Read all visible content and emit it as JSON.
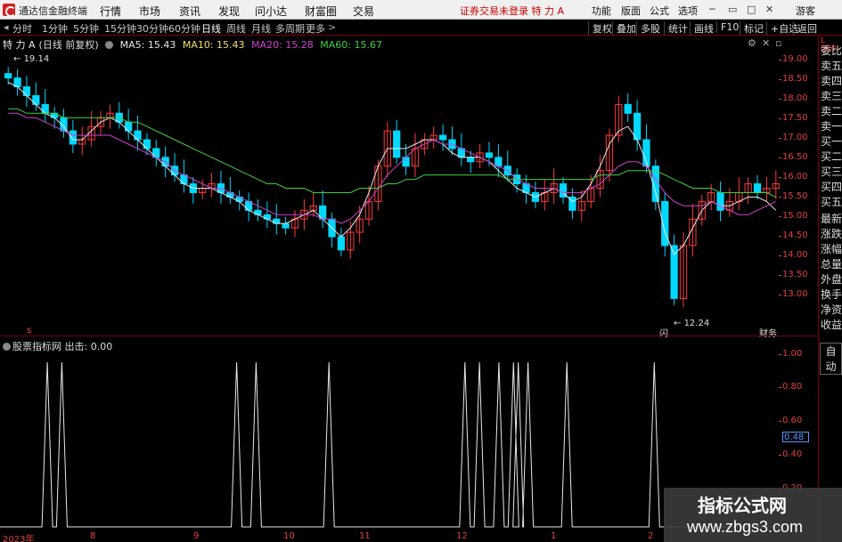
{
  "menubar": {
    "app_title": "通达信金融终端",
    "menus": [
      "行情",
      "市场",
      "资讯",
      "发现",
      "问小达",
      "财富圈",
      "交易"
    ],
    "status_text": "证券交易未登录",
    "stock_title": "特 力 A",
    "right_items": [
      "功能",
      "版面",
      "公式",
      "选项"
    ],
    "user": "游客"
  },
  "periods": {
    "tabs": [
      "分时",
      "1分钟",
      "5分钟",
      "15分钟",
      "30分钟",
      "60分钟",
      "日线",
      "周线",
      "月线",
      "多周期",
      "更多"
    ],
    "active": "日线",
    "more_arrow": ">",
    "tools": [
      "复权",
      "叠加",
      "多股",
      "统计",
      "画线",
      "F10",
      "标记",
      "+自选",
      "返回"
    ]
  },
  "main_chart": {
    "stock": "特 力 A",
    "period_note": "(日线 前复权)",
    "ma_labels": [
      {
        "text": "MA5: 15.43",
        "color": "#e8e8e8"
      },
      {
        "text": "MA10: 15.43",
        "color": "#f0e060"
      },
      {
        "text": "MA20: 15.28",
        "color": "#d040d0"
      },
      {
        "text": "MA60: 15.67",
        "color": "#40d040"
      }
    ],
    "max_label": "19.14",
    "min_label": "12.24",
    "marker_cai": "财务",
    "marker_shan": "闪",
    "marker_s": "s",
    "y_ticks": [
      "19.00",
      "18.50",
      "18.00",
      "17.50",
      "17.00",
      "16.50",
      "16.00",
      "15.50",
      "15.00",
      "14.50",
      "14.00",
      "13.50",
      "13.00"
    ]
  },
  "sub_chart": {
    "title": "股票指标网",
    "value_label": "出击: 0.00",
    "y_ticks": [
      "1.00",
      "0.80",
      "0.60",
      "0.40",
      "0.20"
    ],
    "cursor_value": "0.48"
  },
  "time_axis": [
    "2023年",
    "8",
    "9",
    "10",
    "11",
    "12",
    "1",
    "2"
  ],
  "right_panel": {
    "top_label": "L 000",
    "items": [
      "委比",
      "卖五",
      "卖四",
      "卖三",
      "卖二",
      "卖一",
      "买一",
      "买二",
      "买三",
      "买四",
      "买五",
      "最新",
      "涨跌",
      "涨幅",
      "总量",
      "外盘",
      "换手",
      "净资",
      "收益"
    ],
    "auto": "自动"
  },
  "watermark": {
    "line1": "指标公式网",
    "line2": "www.zbgs3.com"
  },
  "chart_data": [
    {
      "type": "line",
      "description_series": "price_closes_daily_approx",
      "series": [
        {
          "name": "K线收盘",
          "values": [
            18.4,
            18.2,
            18.0,
            17.8,
            17.6,
            17.5,
            17.2,
            16.9,
            17.0,
            17.3,
            17.5,
            17.6,
            17.4,
            17.2,
            17.0,
            16.8,
            16.6,
            16.4,
            16.2,
            16.0,
            15.8,
            15.9,
            16.0,
            15.8,
            15.7,
            15.6,
            15.4,
            15.3,
            15.2,
            15.1,
            15.0,
            15.2,
            15.4,
            15.5,
            15.2,
            14.8,
            14.5,
            14.9,
            15.2,
            15.6,
            16.4,
            17.2,
            16.6,
            16.4,
            16.8,
            17.0,
            17.1,
            17.0,
            16.8,
            16.6,
            16.5,
            16.7,
            16.6,
            16.4,
            16.2,
            16.0,
            15.8,
            15.6,
            15.8,
            16.0,
            15.7,
            15.4,
            15.6,
            15.9,
            16.3,
            17.1,
            17.8,
            17.6,
            17.0,
            16.4,
            15.6,
            14.6,
            13.4,
            14.6,
            15.2,
            15.6,
            15.8,
            15.4,
            15.6,
            15.8,
            16.0,
            15.8,
            15.9,
            16.0
          ]
        },
        {
          "name": "MA5",
          "values": [
            18.3,
            18.2,
            18.0,
            17.8,
            17.6,
            17.5,
            17.3,
            17.0,
            17.0,
            17.2,
            17.4,
            17.5,
            17.4,
            17.2,
            17.0,
            16.8,
            16.6,
            16.4,
            16.2,
            16.0,
            15.9,
            15.9,
            15.9,
            15.8,
            15.7,
            15.6,
            15.4,
            15.3,
            15.2,
            15.1,
            15.1,
            15.2,
            15.3,
            15.4,
            15.2,
            15.0,
            14.8,
            15.0,
            15.3,
            15.8,
            16.4,
            16.8,
            16.8,
            16.8,
            16.9,
            17.0,
            17.0,
            16.9,
            16.7,
            16.6,
            16.6,
            16.6,
            16.5,
            16.3,
            16.1,
            15.9,
            15.8,
            15.7,
            15.8,
            15.9,
            15.8,
            15.6,
            15.7,
            16.0,
            16.4,
            16.9,
            17.2,
            17.3,
            17.0,
            16.5,
            15.8,
            14.9,
            14.4,
            14.6,
            15.0,
            15.4,
            15.6,
            15.5,
            15.5,
            15.6,
            15.7,
            15.7,
            15.6,
            15.4
          ]
        },
        {
          "name": "MA20",
          "values": [
            17.6,
            17.6,
            17.5,
            17.5,
            17.4,
            17.3,
            17.2,
            17.1,
            17.1,
            17.1,
            17.1,
            17.1,
            17.0,
            16.9,
            16.8,
            16.7,
            16.6,
            16.5,
            16.3,
            16.2,
            16.1,
            16.0,
            15.9,
            15.9,
            15.8,
            15.7,
            15.6,
            15.5,
            15.4,
            15.3,
            15.3,
            15.3,
            15.3,
            15.3,
            15.2,
            15.2,
            15.1,
            15.2,
            15.4,
            15.6,
            15.9,
            16.2,
            16.4,
            16.6,
            16.8,
            16.9,
            17.0,
            16.9,
            16.9,
            16.8,
            16.7,
            16.6,
            16.5,
            16.4,
            16.3,
            16.1,
            16.0,
            15.9,
            15.9,
            15.9,
            15.8,
            15.8,
            15.8,
            15.9,
            16.0,
            16.2,
            16.4,
            16.5,
            16.5,
            16.4,
            16.1,
            15.8,
            15.6,
            15.5,
            15.5,
            15.5,
            15.6,
            15.5,
            15.4,
            15.3,
            15.3,
            15.4,
            15.5,
            15.6
          ]
        },
        {
          "name": "MA60",
          "values": [
            17.7,
            17.7,
            17.6,
            17.6,
            17.6,
            17.6,
            17.5,
            17.5,
            17.5,
            17.5,
            17.5,
            17.5,
            17.5,
            17.4,
            17.4,
            17.3,
            17.2,
            17.1,
            17.0,
            16.9,
            16.8,
            16.7,
            16.6,
            16.5,
            16.4,
            16.3,
            16.2,
            16.1,
            16.0,
            16.0,
            15.9,
            15.9,
            15.9,
            15.8,
            15.8,
            15.8,
            15.8,
            15.8,
            15.9,
            15.9,
            15.9,
            16.0,
            16.0,
            16.1,
            16.1,
            16.2,
            16.2,
            16.2,
            16.2,
            16.2,
            16.2,
            16.2,
            16.2,
            16.2,
            16.1,
            16.1,
            16.1,
            16.1,
            16.1,
            16.1,
            16.1,
            16.1,
            16.1,
            16.1,
            16.2,
            16.2,
            16.2,
            16.3,
            16.3,
            16.3,
            16.3,
            16.2,
            16.1,
            16.0,
            15.9,
            15.9,
            15.9,
            15.8,
            15.8,
            15.8,
            15.8,
            15.8,
            15.8,
            15.7
          ]
        }
      ],
      "ylim": [
        12.6,
        19.2
      ]
    },
    {
      "type": "line",
      "series": [
        {
          "name": "出击",
          "spikes_at_index": [
            9,
            12,
            48,
            52,
            67,
            95,
            98,
            102,
            105,
            106,
            108,
            116,
            134
          ]
        }
      ],
      "ylim": [
        0,
        1.05
      ]
    }
  ],
  "colors": {
    "up": "#ff3b3b",
    "down": "#00d8ff",
    "ma5": "#e8e8e8",
    "ma10": "#f0e060",
    "ma20": "#d040d0",
    "ma60": "#40d040",
    "axis": "#e04040",
    "border": "#7a0000"
  }
}
